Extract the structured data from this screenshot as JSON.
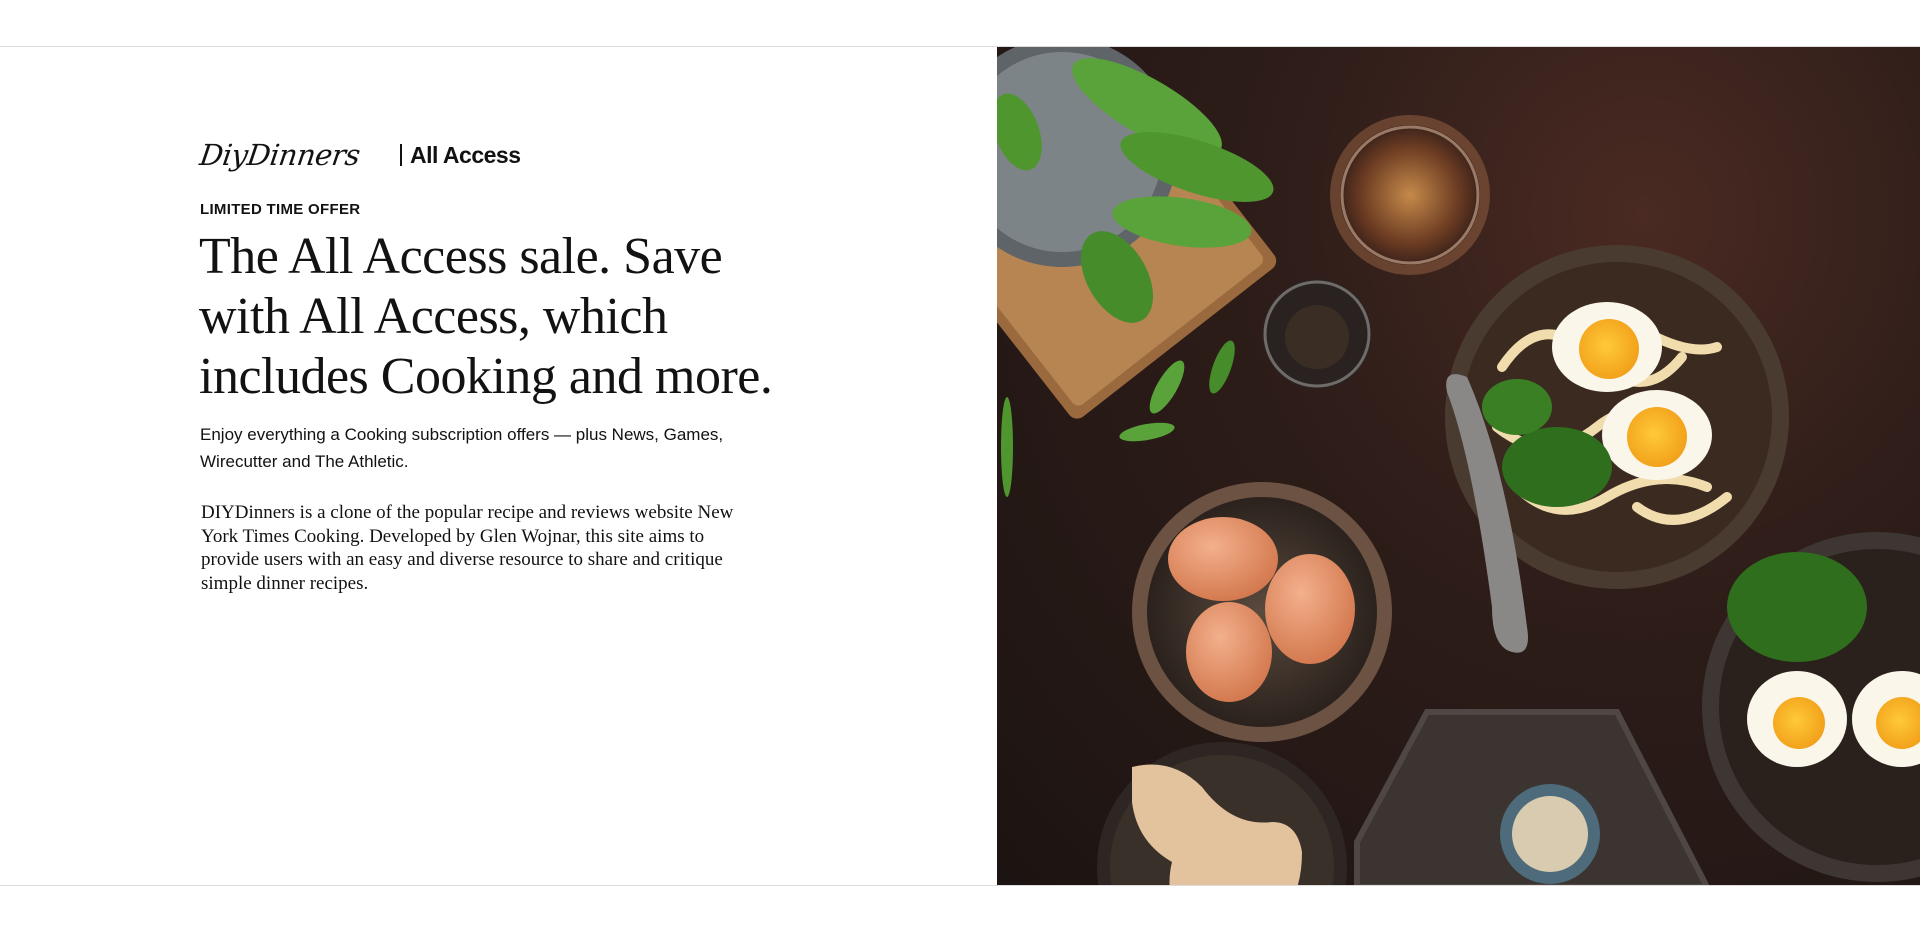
{
  "brand": {
    "logo": "DiyDinners",
    "product": "All Access"
  },
  "offer": {
    "eyebrow": "LIMITED TIME OFFER",
    "headline": "The All Access sale. Save with All Access, which includes Cooking and more.",
    "subcopy": "Enjoy everything a Cooking subscription offers — plus News, Games, Wirecutter and The Athletic.",
    "about": "DIYDinners is a clone of the popular recipe and reviews website New York Times Cooking. Developed by Glen Wojnar, this site aims to provide users with an easy and diverse resource to share and critique simple dinner recipes."
  },
  "colors": {
    "text": "#121212",
    "rule": "#dcdcdc",
    "photo_background": "#2e1d19"
  },
  "image": {
    "icon": "food-photo-ramen-eggs-spinach"
  }
}
